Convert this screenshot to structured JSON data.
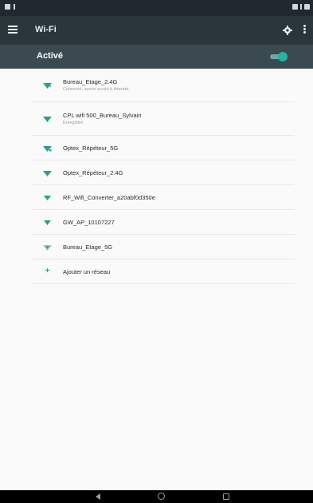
{
  "toolbar": {
    "title": "Wi-Fi"
  },
  "switch_bar": {
    "label": "Activé",
    "enabled": true
  },
  "networks": [
    {
      "name": "Bureau_Etage_2.4G",
      "summary": "Connecté, aucun accès à Internet",
      "signal_icon": "wifi-signal-icon",
      "locked": false
    },
    {
      "name": "CPL wifi 500_Bureau_Sylvain",
      "summary": "Enregistré",
      "signal_icon": "wifi-signal-icon",
      "locked": false
    },
    {
      "name": "Optex_Répéteur_5G",
      "summary": "",
      "signal_icon": "wifi-signal-icon",
      "locked": false
    },
    {
      "name": "Optex_Répéteur_2.4G",
      "summary": "",
      "signal_icon": "wifi-signal-icon",
      "locked": false
    },
    {
      "name": "RF_Wifi_Converter_a20abf0d350e",
      "summary": "",
      "signal_icon": "wifi-signal-icon",
      "locked": false
    },
    {
      "name": "GW_AP_10107227",
      "summary": "",
      "signal_icon": "wifi-signal-icon",
      "locked": false
    },
    {
      "name": "Bureau_Etage_5G",
      "summary": "",
      "signal_icon": "wifi-signal-icon",
      "locked": false
    }
  ],
  "add_network": {
    "label": "Ajouter un réseau",
    "icon": "plus-icon"
  },
  "colors": {
    "toolbar": "#2b363b",
    "switch_bar": "#3a4a50",
    "accent": "#26b3a6"
  }
}
